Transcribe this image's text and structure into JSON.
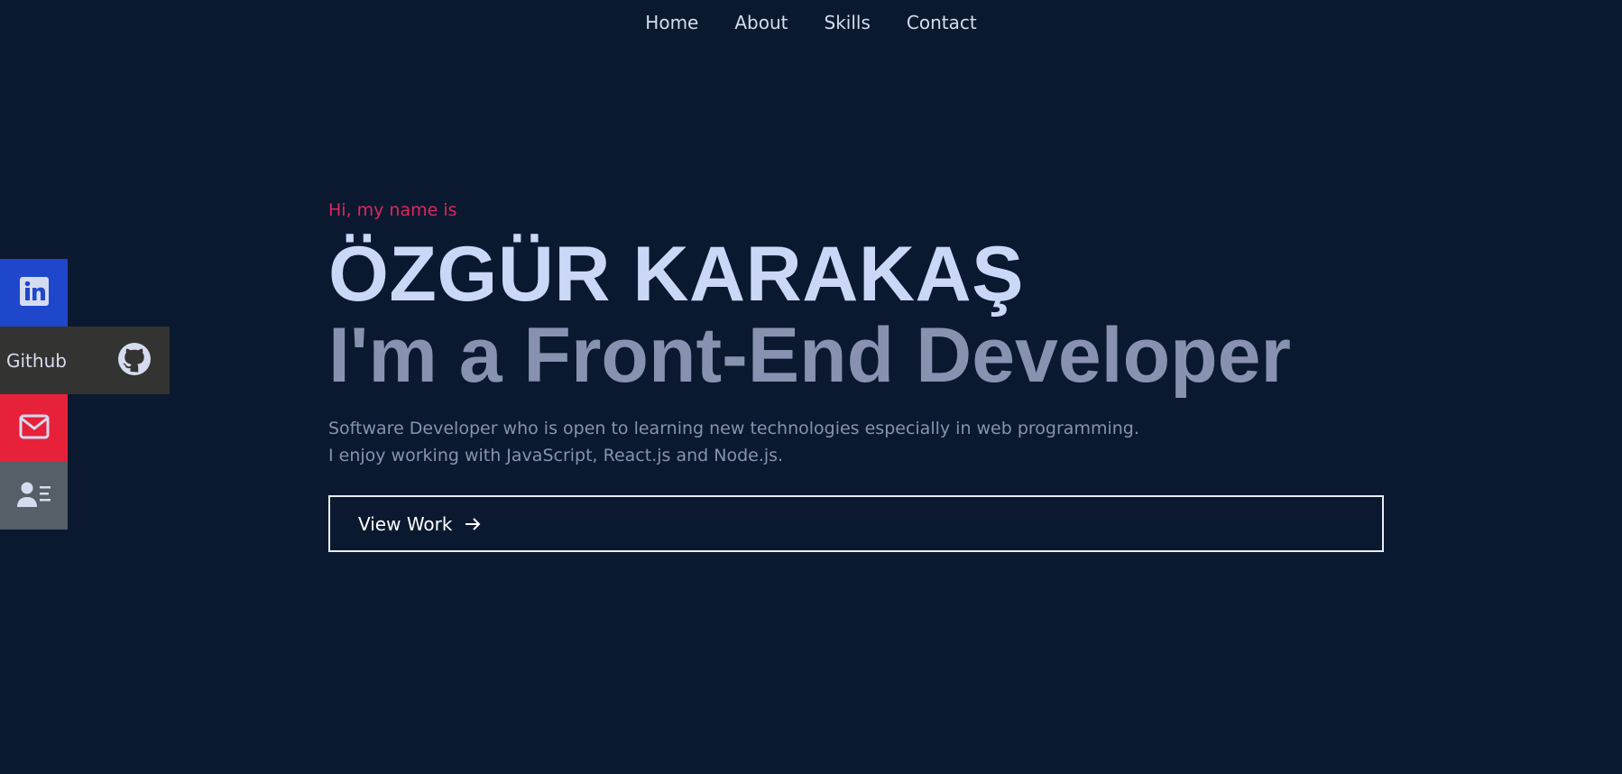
{
  "nav": {
    "items": [
      {
        "label": "Home"
      },
      {
        "label": "About"
      },
      {
        "label": "Skills"
      },
      {
        "label": "Contact"
      }
    ]
  },
  "social": {
    "linkedin": {
      "icon": "linkedin-icon",
      "color": "#1e47cc"
    },
    "github": {
      "label": "Github",
      "icon": "github-icon",
      "color": "#333331"
    },
    "mail": {
      "icon": "mail-icon",
      "color": "#e8213a"
    },
    "resume": {
      "icon": "resume-icon",
      "color": "#565f68"
    }
  },
  "hero": {
    "greeting": "Hi, my name is",
    "name": "ÖZGÜR KARAKAŞ",
    "role": "I'm a Front-End Developer",
    "description": [
      "Software Developer who is open to learning new technologies especially in web programming.",
      "I enjoy working with JavaScript, React.js and Node.js."
    ],
    "cta_label": "View Work",
    "cta_icon": "arrow-right-icon"
  },
  "colors": {
    "background": "#0a192f",
    "accent": "#e0265f",
    "name": "#ccd6f6",
    "muted": "#8892b0"
  }
}
